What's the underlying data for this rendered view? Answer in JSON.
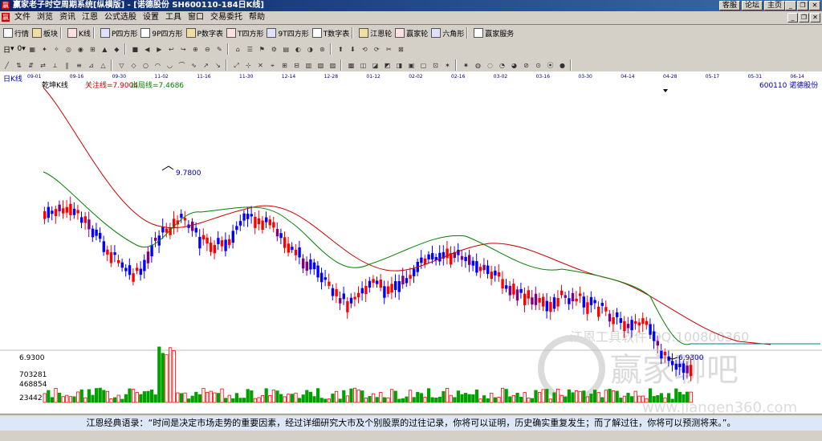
{
  "window": {
    "title": "赢家老子时空周期系统[纵横版] - [诺德股份  SH600110-184日K线]",
    "links": [
      "客服",
      "论坛",
      "主页"
    ]
  },
  "menu": [
    "文件",
    "浏览",
    "资讯",
    "江恩",
    "公式选股",
    "设置",
    "工具",
    "窗口",
    "交易委托",
    "帮助"
  ],
  "toolbar1": [
    {
      "label": "行情",
      "icon": "grid-icon"
    },
    {
      "label": "板块",
      "icon": "blocks-icon"
    },
    {
      "label": "K线",
      "icon": "candle-icon"
    },
    {
      "label": "P四方形",
      "icon": "square-icon"
    },
    {
      "label": "9P四方形",
      "icon": "square-icon"
    },
    {
      "label": "P数字表",
      "icon": "square-icon"
    },
    {
      "label": "T四方形",
      "icon": "square-icon"
    },
    {
      "label": "9T四方形",
      "icon": "square-icon"
    },
    {
      "label": "T数字表",
      "icon": "square-icon"
    },
    {
      "label": "江恩轮",
      "icon": "wheel-icon"
    },
    {
      "label": "赢家轮",
      "icon": "wheel-icon"
    },
    {
      "label": "六角形",
      "icon": "hexagon-icon"
    },
    {
      "label": "赢家服务",
      "icon": "service-icon"
    }
  ],
  "toolbar2": [
    {
      "label": "日",
      "icon": "period-dropdown"
    },
    {
      "label": "0",
      "icon": "number-dropdown"
    }
  ],
  "chart": {
    "period_label": "日K线",
    "indicator_name": "乾坤K线",
    "focus_line_label": "关注线=7.9004",
    "exit_line_label": "出局线=7.4686",
    "stock_label": "600110  诺德股份",
    "high_label": "9.7800",
    "low_label": "6.9300",
    "dates": [
      "09-01",
      "09-16",
      "09-30",
      "11-02",
      "11-16",
      "11-30",
      "12-14",
      "12-28",
      "01-12",
      "02-02",
      "02-16",
      "03-02",
      "03-16",
      "03-30",
      "04-14",
      "04-28",
      "05-17",
      "05-31",
      "06-14"
    ],
    "volume_ticks": [
      "703281",
      "468854",
      "234427"
    ],
    "volume_top_price": "6.9300",
    "colors": {
      "up": "#ff0000",
      "down": "#0000ff",
      "flat": "#800080",
      "ma_red": "#cc0000",
      "ma_green": "#008000",
      "volume_up": "#ff0000",
      "volume_down": "#00a000"
    }
  },
  "watermark": {
    "line1": "江恩工具软件 QQ:100800360",
    "line2": "赢家聊吧",
    "line3": "www.jiangen360.com"
  },
  "status": {
    "quote": "江恩经典语录：“时间是决定市场走势的重要因素，经过详细研究大市及个别股票的过往记录，你将可以证明，历史确实重复发生；而了解过往，你将可以预测将来。”。"
  }
}
